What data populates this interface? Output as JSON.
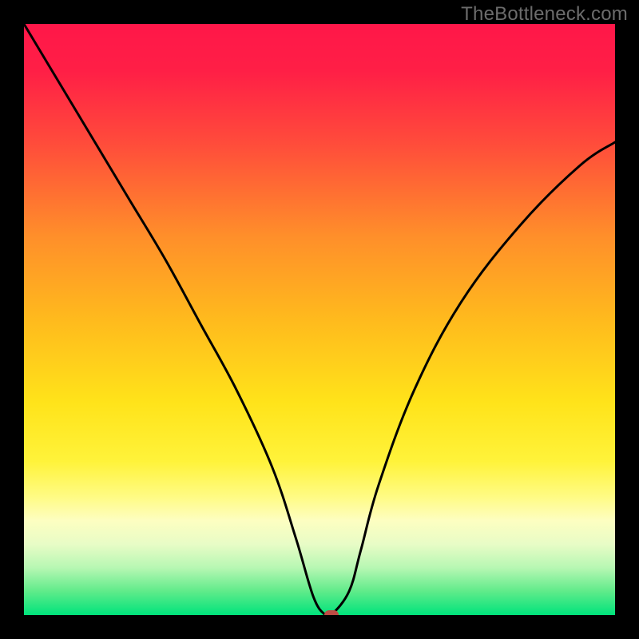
{
  "watermark": "TheBottleneck.com",
  "chart_data": {
    "type": "line",
    "title": "",
    "xlabel": "",
    "ylabel": "",
    "xlim": [
      0,
      100
    ],
    "ylim": [
      0,
      100
    ],
    "grid": false,
    "legend": false,
    "background": {
      "kind": "vertical-gradient",
      "stops": [
        {
          "pos": 0,
          "color": "#ff1749"
        },
        {
          "pos": 0.5,
          "color": "#ffba1d"
        },
        {
          "pos": 0.8,
          "color": "#fffb84"
        },
        {
          "pos": 1.0,
          "color": "#00e37c"
        }
      ]
    },
    "series": [
      {
        "name": "bottleneck-curve",
        "x": [
          0,
          6,
          12,
          18,
          24,
          30,
          36,
          42,
          46,
          49,
          51,
          52,
          55,
          57,
          60,
          66,
          74,
          84,
          94,
          100
        ],
        "y": [
          100,
          90,
          80,
          70,
          60,
          49,
          38,
          25,
          13,
          3,
          0,
          0,
          4,
          11,
          22,
          38,
          53,
          66,
          76,
          80
        ]
      }
    ],
    "marker": {
      "x": 52,
      "y": 0,
      "color": "#bd4c44"
    }
  }
}
